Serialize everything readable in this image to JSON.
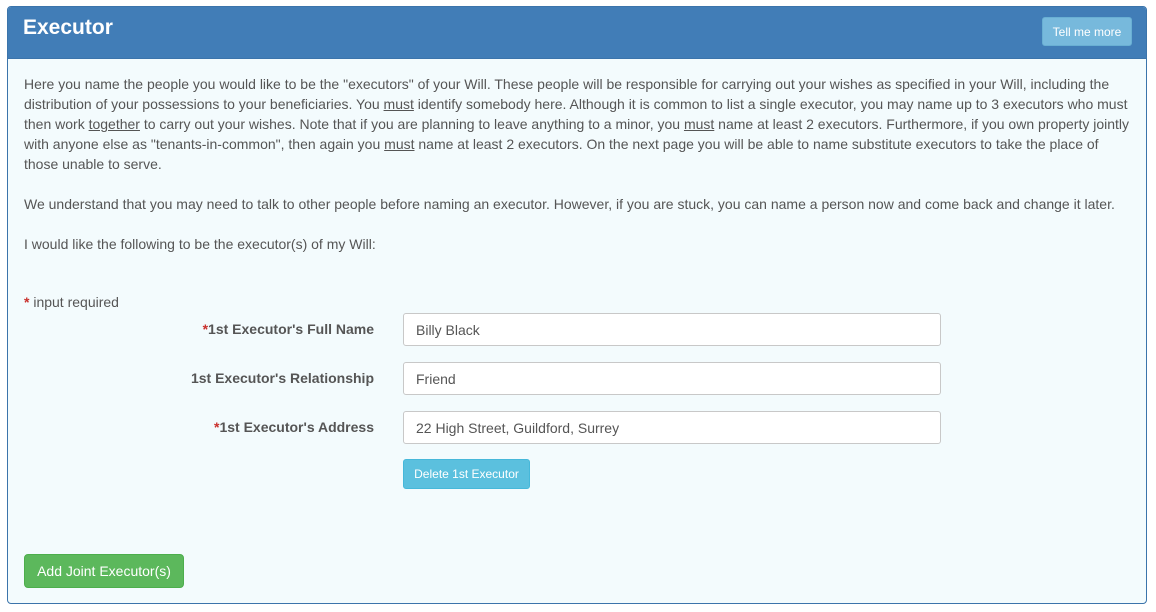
{
  "header": {
    "title": "Executor",
    "tell_me_more_label": "Tell me more"
  },
  "intro": {
    "p1": [
      "Here you name the people you would like to be the \"executors\" of your Will. These people will be responsible for carrying out your wishes as specified in your Will, including the distribution of your possessions to your beneficiaries. You ",
      "must",
      " identify somebody here. Although it is common to list a single executor, you may name up to 3 executors who must then work ",
      "together",
      " to carry out your wishes. Note that if you are planning to leave anything to a minor, you ",
      "must",
      " name at least 2 executors. Furthermore, if you own property jointly with anyone else as \"tenants-in-common\", then again you ",
      "must",
      " name at least 2 executors. On the next page you will be able to name substitute executors to take the place of those unable to serve."
    ],
    "p2": "We understand that you may need to talk to other people before naming an executor. However, if you are stuck, you can name a person now and come back and change it later.",
    "p3": "I would like the following to be the executor(s) of my Will:"
  },
  "form": {
    "required_star": "*",
    "required_note": " input required",
    "fields": [
      {
        "label": "1st Executor's Full Name",
        "required": true,
        "value": "Billy Black"
      },
      {
        "label": "1st Executor's Relationship",
        "required": false,
        "value": "Friend"
      },
      {
        "label": "1st Executor's Address",
        "required": true,
        "value": "22 High Street, Guildford, Surrey"
      }
    ],
    "delete_label": "Delete 1st Executor",
    "add_label": "Add Joint Executor(s)"
  },
  "colors": {
    "header_bg": "#417db7",
    "panel_bg": "#f3fbfd",
    "info_button": "#5bc0de",
    "success_button": "#5cb85c",
    "required_star": "#c9302c"
  }
}
